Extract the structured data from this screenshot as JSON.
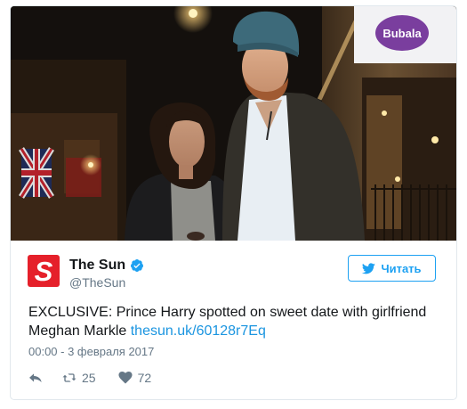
{
  "photo": {
    "alt_subject": "couple-at-night-street",
    "shop_sign_text": "Bubala",
    "colors": {
      "sky": "#14100d",
      "coat": "#33302a",
      "beanie": "#3d6a7a",
      "shirt": "#e8eef3"
    }
  },
  "author": {
    "logo_letter": "S",
    "display_name": "The Sun",
    "screen_name": "@TheSun",
    "verified": true
  },
  "follow_button": {
    "label": "Читать",
    "icon": "bird-icon"
  },
  "tweet": {
    "text": "EXCLUSIVE: Prince Harry spotted on sweet date with girlfriend Meghan Markle",
    "link_text": "thesun.uk/60128r7Eq",
    "timestamp": "00:00 - 3 февраля 2017"
  },
  "actions": {
    "reply": {
      "icon": "reply-icon"
    },
    "retweet": {
      "icon": "retweet-icon",
      "count": "25"
    },
    "like": {
      "icon": "heart-icon",
      "count": "72"
    }
  },
  "colors": {
    "accent": "#1da1f2",
    "link": "#1b95e0",
    "muted": "#657786",
    "brand_red": "#e5202a"
  }
}
